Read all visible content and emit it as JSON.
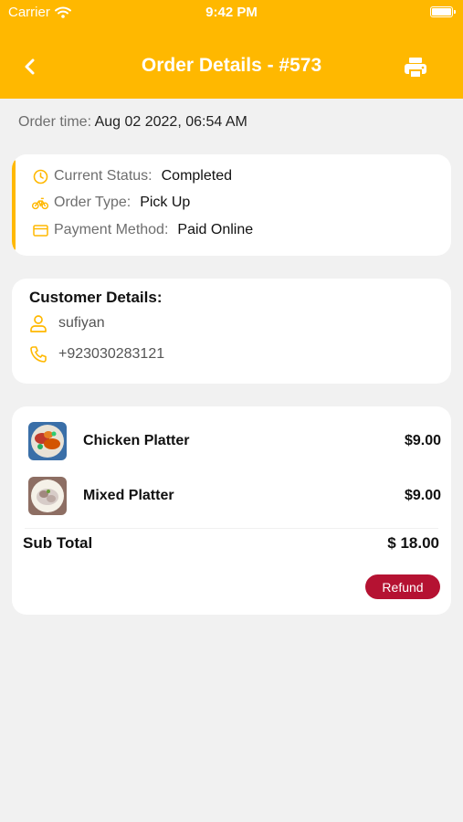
{
  "status_bar": {
    "carrier": "Carrier",
    "time": "9:42 PM"
  },
  "header": {
    "title": "Order Details - #573",
    "back_icon": "chevron-left-icon",
    "print_icon": "printer-icon"
  },
  "order_time": {
    "label": "Order time:",
    "value": "Aug 02 2022, 06:54 AM"
  },
  "status_card": {
    "current_status_label": "Current Status:",
    "current_status_value": "Completed",
    "order_type_label": "Order Type:",
    "order_type_value": "Pick Up",
    "payment_method_label": "Payment Method:",
    "payment_method_value": "Paid Online"
  },
  "customer": {
    "title": "Customer Details:",
    "name": "sufiyan",
    "phone": "+923030283121"
  },
  "items": [
    {
      "name": "Chicken Platter",
      "price": "$9.00"
    },
    {
      "name": "Mixed Platter",
      "price": "$9.00"
    }
  ],
  "subtotal": {
    "label": "Sub Total",
    "value": "$ 18.00"
  },
  "refund_label": "Refund",
  "colors": {
    "accent": "#FFB800",
    "refund": "#B51232",
    "background": "#F1F1F1"
  }
}
